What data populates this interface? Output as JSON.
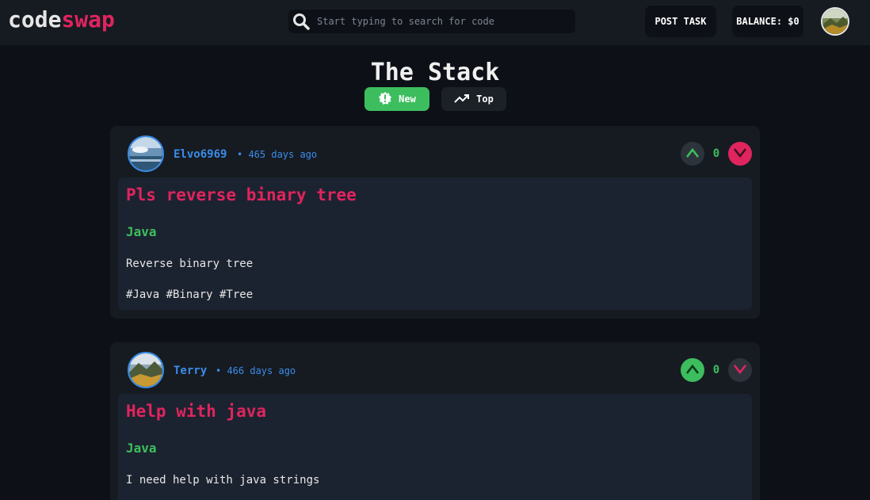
{
  "header": {
    "logo_part1": "code",
    "logo_part2": "swap",
    "search_placeholder": "Start typing to search for code",
    "post_task_label": "POST TASK",
    "balance_label": "BALANCE: $0"
  },
  "page": {
    "title": "The Stack",
    "tabs": [
      {
        "label": "New",
        "icon": "alert-badge-icon",
        "active": true
      },
      {
        "label": "Top",
        "icon": "trending-up-icon",
        "active": false
      }
    ]
  },
  "posts": [
    {
      "user": "Elvo6969",
      "ago": "• 465 days ago",
      "votes": "0",
      "title": "Pls reverse binary tree",
      "language": "Java",
      "description": "Reverse binary tree",
      "tags": "#Java #Binary #Tree",
      "downvote_active": true,
      "upvote_active": false
    },
    {
      "user": "Terry",
      "ago": "• 466 days ago",
      "votes": "0",
      "title": "Help with java",
      "language": "Java",
      "description": "I need help with java strings",
      "tags": "",
      "downvote_active": false,
      "upvote_active": true
    }
  ],
  "colors": {
    "accent_pink": "#e0245e",
    "accent_green": "#3dbe5e",
    "accent_blue": "#3b8ce8",
    "background": "#0d1117",
    "panel": "#161b22"
  }
}
